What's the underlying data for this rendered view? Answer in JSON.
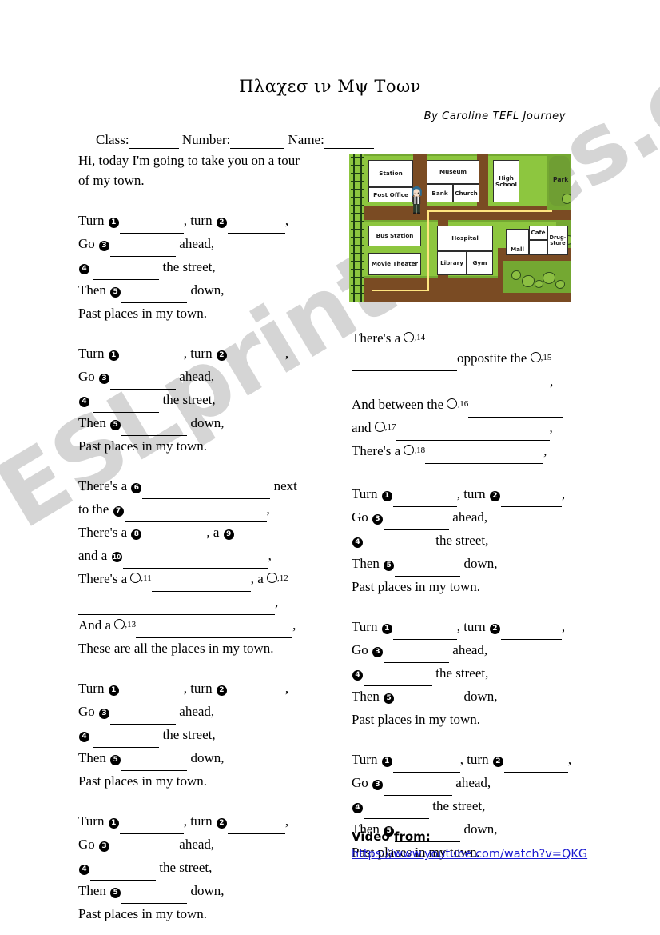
{
  "title": "Πλαχεσ ιν Μψ Τοων",
  "byline": "By Caroline TEFL Journey",
  "watermark": "ESLprintables.com",
  "header": {
    "class_label": "Class:",
    "number_label": "Number:",
    "name_label": "Name:"
  },
  "intro": {
    "line1": "Hi, today I'm going to take you on a tour",
    "line2": "of my town."
  },
  "verse": {
    "turn_a": "Turn",
    "turn_b": ", turn",
    "turn_end": ",",
    "go": "Go",
    "ahead": "ahead,",
    "street": "the street,",
    "then": "Then",
    "down": "down,",
    "past": "Past places in my town."
  },
  "places_left": {
    "l1_a": "There's a",
    "l1_b": "next",
    "l2_a": "to the",
    "l2_b": ",",
    "l3_a": "There's a",
    "l3_b": ", a",
    "l4_a": "and a",
    "l4_b": ",",
    "l5_a": "There's a",
    "l5_b": ", a",
    "l6_b": ",",
    "l7_a": "And a",
    "l7_b": ",",
    "l8": "These are all the places in my town."
  },
  "places_right": {
    "r1_a": "There's a",
    "r2_b": "oppostite the",
    "r3_b": ",",
    "r4_a": "And between the",
    "r5_a": "and",
    "r5_b": ",",
    "r6_a": "There's a",
    "r6_b": ","
  },
  "numbers": {
    "n1": "1",
    "n2": "2",
    "n3": "3",
    "n4": "4",
    "n5": "5",
    "n6": "6",
    "n7": "7",
    "n8": "8",
    "n9": "9",
    "n10": "10",
    "n11": ",11",
    "n12": ",12",
    "n13": ",13",
    "n14": ",14",
    "n15": ",15",
    "n16": ",16",
    "n17": ",17",
    "n18": ",18"
  },
  "video": {
    "label": "Video   from:",
    "url": "https://www.youtube.com/watch?v=QKG"
  },
  "map": {
    "buildings": [
      "Station",
      "Post Office",
      "Museum",
      "Bank",
      "Church",
      "High School",
      "Bus Station",
      "Movie Theater",
      "Hospital",
      "Library",
      "Gym",
      "Mall",
      "Café",
      "Drug-store"
    ],
    "park_label": "Park",
    "colors": {
      "grass": "#8dc63f",
      "park": "#6f9e33",
      "road": "#7a4b23",
      "route": "#ffe680",
      "rail": "#1d3d14",
      "building": "#ffffff"
    }
  }
}
